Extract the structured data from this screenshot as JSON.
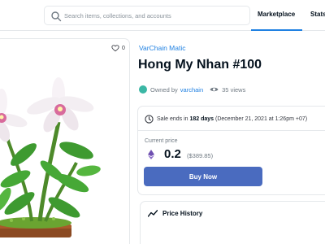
{
  "header": {
    "search_placeholder": "Search items, collections, and accounts",
    "nav": {
      "marketplace": "Marketplace",
      "stats": "Stats"
    }
  },
  "asset": {
    "favorites_count": "0",
    "collection": "VarChain Matic",
    "title": "Hong My Nhan #100",
    "owned_by_prefix": "Owned by",
    "owner": "varchain",
    "views": "35 views"
  },
  "sale": {
    "ends_prefix": "Sale ends in",
    "ends_in": "182 days",
    "ends_date": "(December 21, 2021 at 1:26pm +07)",
    "current_price_label": "Current price",
    "price": "0.2",
    "price_usd": "($389.85)",
    "buy_label": "Buy Now"
  },
  "price_history": {
    "title": "Price History"
  },
  "colors": {
    "accent": "#2081e2",
    "buy_button": "#4a6bbf",
    "avatar": "#3bb7a5",
    "eth_icon": "#6e4fb0"
  },
  "icons": {
    "search": "search-icon",
    "favorite": "heart-icon",
    "views": "eye-icon",
    "sale_timer": "clock-icon",
    "currency": "eth-icon",
    "price_history": "trend-icon"
  }
}
